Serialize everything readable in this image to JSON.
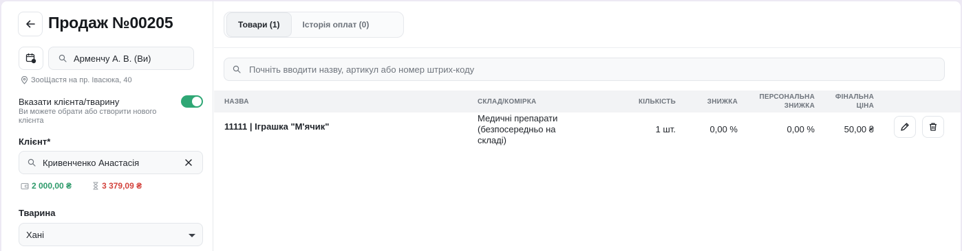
{
  "header": {
    "title": "Продаж №00205"
  },
  "employee": {
    "value": "Арменчу А. В. (Ви)"
  },
  "location": {
    "text": "ЗооЩастя на пр. Івасюка, 40"
  },
  "client_toggle": {
    "title": "Вказати клієнта/тварину",
    "hint": "Ви можете обрати або створити нового клієнта",
    "enabled": true,
    "color": "#2fa775"
  },
  "client": {
    "label": "Клієнт*",
    "value": "Кривенченко Анастасія",
    "balance_green": "2 000,00 ₴",
    "balance_red": "3 379,09 ₴"
  },
  "animal": {
    "label": "Тварина",
    "value": "Хані"
  },
  "tabs": [
    {
      "label": "Товари (1)",
      "active": true
    },
    {
      "label": "Історія оплат (0)",
      "active": false
    }
  ],
  "search": {
    "placeholder": "Почніть вводити назву, артикул або номер штрих-коду"
  },
  "table": {
    "headers": {
      "name": "Назва",
      "warehouse": "Склад/комірка",
      "qty": "Кількість",
      "discount": "Знижка",
      "personal_discount_1": "Персональна",
      "personal_discount_2": "знижка",
      "final_price_1": "Фінальна",
      "final_price_2": "ціна"
    },
    "rows": [
      {
        "name": "11111 | Іграшка \"М'ячик\"",
        "warehouse_1": "Медичні препарати",
        "warehouse_2": "(безпосередньо на",
        "warehouse_3": "складі)",
        "qty": "1 шт.",
        "discount": "0,00 %",
        "personal_discount": "0,00 %",
        "final_price": "50,00 ₴"
      }
    ]
  }
}
